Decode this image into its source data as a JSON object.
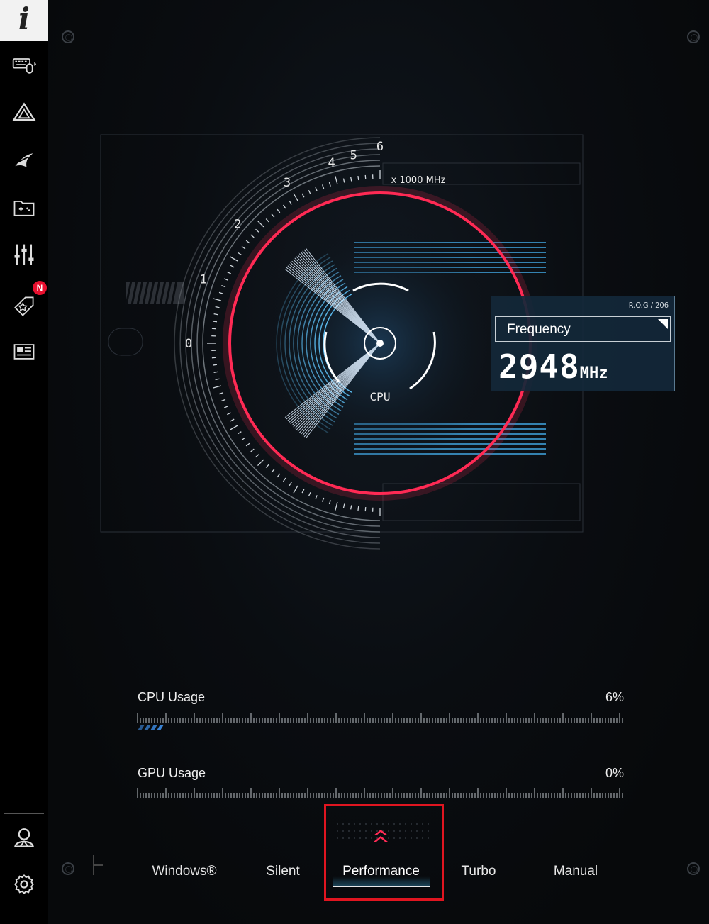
{
  "sidebar": {
    "info_glyph": "i",
    "items": [
      {
        "icon": "keyboard-mouse-icon"
      },
      {
        "icon": "armoury-crate-icon"
      },
      {
        "icon": "rog-logo-icon"
      },
      {
        "icon": "game-library-icon"
      },
      {
        "icon": "settings-sliders-icon"
      },
      {
        "icon": "deals-tag-icon",
        "badge": "N"
      },
      {
        "icon": "news-icon"
      }
    ],
    "bottom": [
      {
        "icon": "user-icon"
      },
      {
        "icon": "gear-icon"
      }
    ]
  },
  "gauge": {
    "scale_labels": [
      "0",
      "1",
      "2",
      "3",
      "4",
      "5",
      "6"
    ],
    "unit_label": "x 1000 MHz",
    "center_label": "CPU",
    "colors": {
      "red_arc": "#ff2a55",
      "blue_rings": "#4fb0e8"
    }
  },
  "frequency": {
    "tag": "R.O.G / 206",
    "label": "Frequency",
    "value": "2948",
    "unit": "MHz"
  },
  "usage": {
    "cpu": {
      "label": "CPU Usage",
      "value": "6%",
      "level": 0.06
    },
    "gpu": {
      "label": "GPU Usage",
      "value": "0%",
      "level": 0.0
    }
  },
  "modes": {
    "tabs": [
      "Windows®",
      "Silent",
      "Performance",
      "Turbo",
      "Manual"
    ],
    "selected": "Performance",
    "accent": "#e01520"
  }
}
